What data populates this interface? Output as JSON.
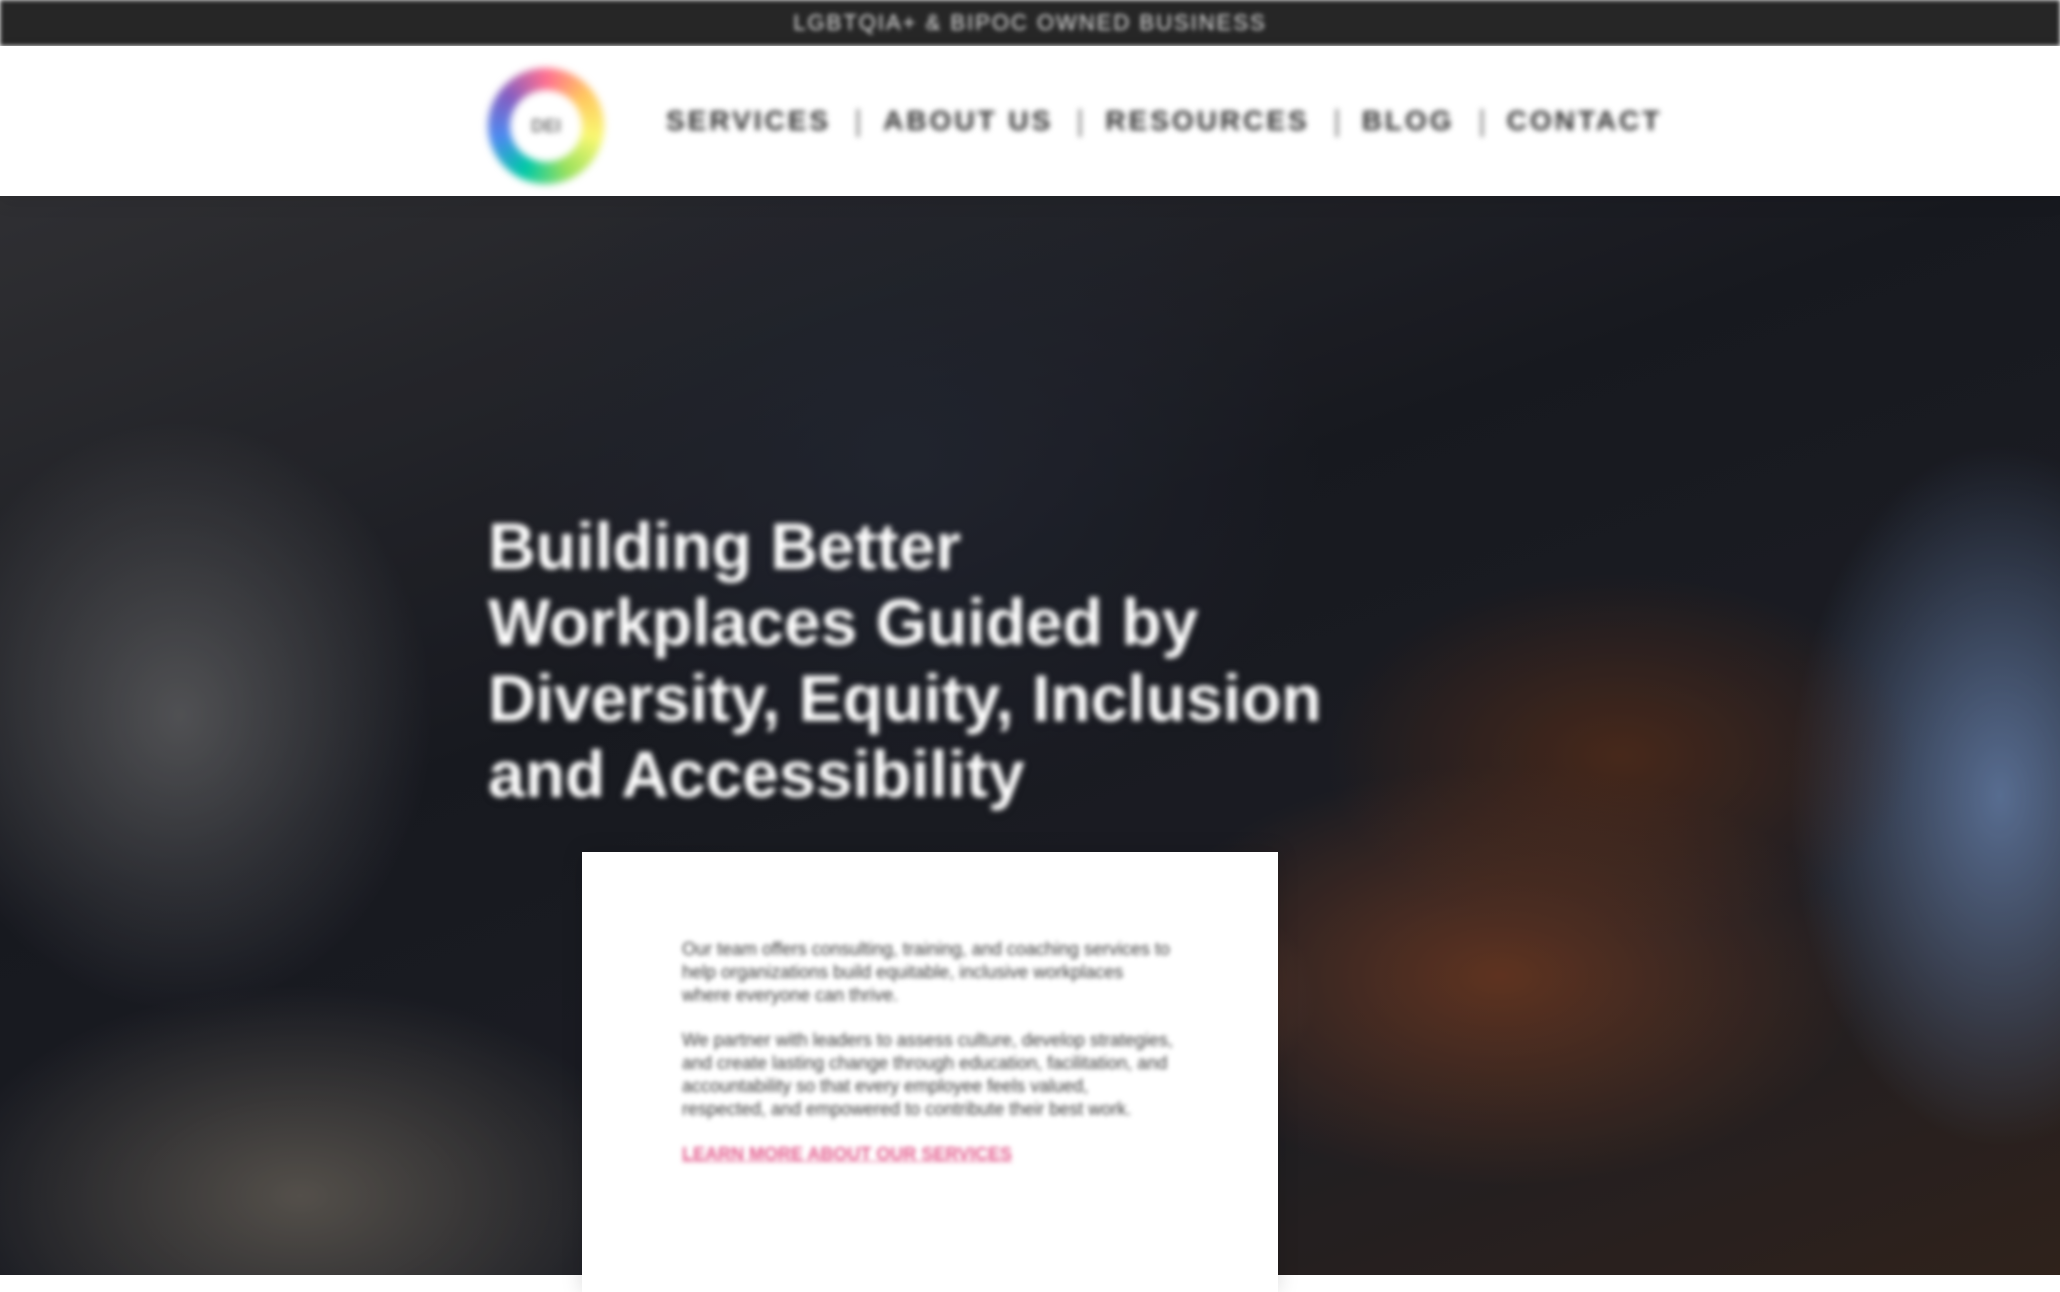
{
  "topbar": {
    "text": "LGBTQIA+ & BIPOC OWNED BUSINESS"
  },
  "header": {
    "logo_text": "DEI",
    "nav": [
      {
        "label": "SERVICES"
      },
      {
        "label": "ABOUT US"
      },
      {
        "label": "RESOURCES"
      },
      {
        "label": "BLOG"
      },
      {
        "label": "CONTACT"
      }
    ]
  },
  "hero": {
    "title": "Building Better Workplaces Guided by Diversity, Equity, Inclusion and Accessibility"
  },
  "card": {
    "paragraph_1": "Our team offers consulting, training, and coaching services to help organizations build equitable, inclusive workplaces where everyone can thrive.",
    "paragraph_2": "We partner with leaders to assess culture, develop strategies, and create lasting change through education, facilitation, and accountability so that every employee feels valued, respected, and empowered to contribute their best work.",
    "link": "LEARN MORE ABOUT OUR SERVICES"
  },
  "colors": {
    "topbar_bg": "#262626",
    "accent_pink": "#e35a8c",
    "nav_text": "#2c2c2c"
  }
}
